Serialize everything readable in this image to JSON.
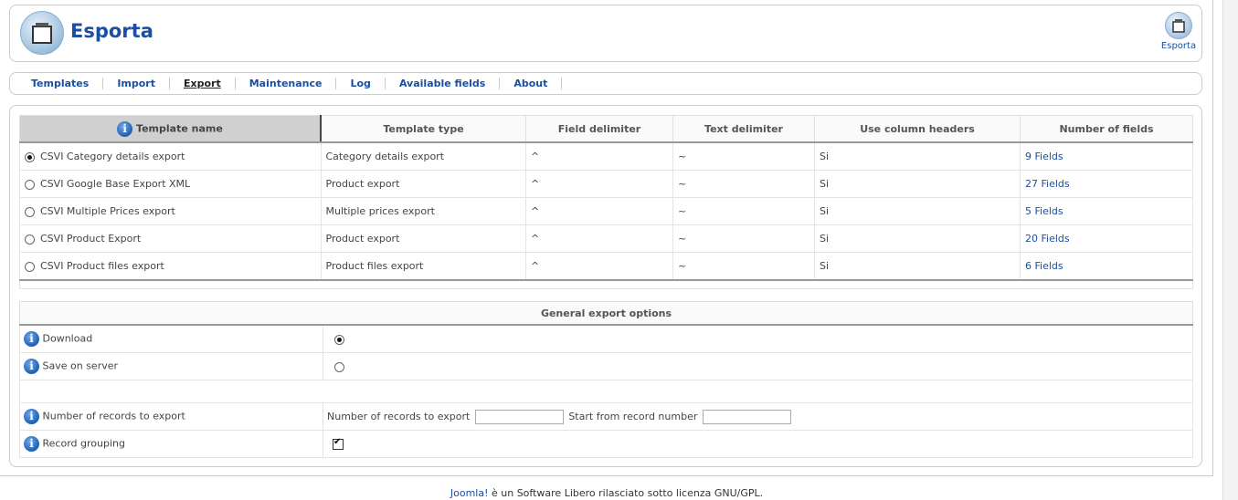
{
  "header": {
    "title": "Esporta",
    "toolbar_button_label": "Esporta"
  },
  "tabs": [
    {
      "label": "Templates",
      "active": false
    },
    {
      "label": "Import",
      "active": false
    },
    {
      "label": "Export",
      "active": true
    },
    {
      "label": "Maintenance",
      "active": false
    },
    {
      "label": "Log",
      "active": false
    },
    {
      "label": "Available fields",
      "active": false
    },
    {
      "label": "About",
      "active": false
    }
  ],
  "templates_table": {
    "columns": [
      "Template name",
      "Template type",
      "Field delimiter",
      "Text delimiter",
      "Use column headers",
      "Number of fields"
    ],
    "rows": [
      {
        "name": "CSVI Category details export",
        "type": "Category details export",
        "field_delim": "^",
        "text_delim": "~",
        "headers": "Si",
        "fields": "9 Fields",
        "selected": true
      },
      {
        "name": "CSVI Google Base Export XML",
        "type": "Product export",
        "field_delim": "^",
        "text_delim": "~",
        "headers": "Si",
        "fields": "27 Fields",
        "selected": false
      },
      {
        "name": "CSVI Multiple Prices export",
        "type": "Multiple prices export",
        "field_delim": "^",
        "text_delim": "~",
        "headers": "Si",
        "fields": "5 Fields",
        "selected": false
      },
      {
        "name": "CSVI Product Export",
        "type": "Product export",
        "field_delim": "^",
        "text_delim": "~",
        "headers": "Si",
        "fields": "20 Fields",
        "selected": false
      },
      {
        "name": "CSVI Product files export",
        "type": "Product files export",
        "field_delim": "^",
        "text_delim": "~",
        "headers": "Si",
        "fields": "6 Fields",
        "selected": false
      }
    ]
  },
  "options": {
    "title": "General export options",
    "download_label": "Download",
    "save_label": "Save on server",
    "records_label": "Number of records to export",
    "records_inline_label": "Number of records to export",
    "records_value": "",
    "start_label": "Start from record number",
    "start_value": "",
    "grouping_label": "Record grouping"
  },
  "footer": {
    "link": "Joomla!",
    "text": " è un Software Libero rilasciato sotto licenza GNU/GPL."
  },
  "colors": {
    "link": "#1a4fa0",
    "border": "#cccccc"
  }
}
